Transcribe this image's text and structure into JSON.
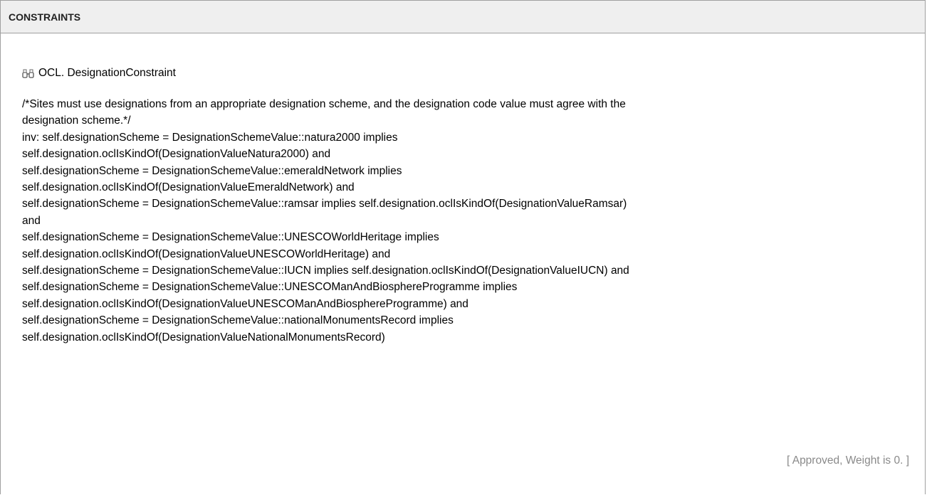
{
  "section": {
    "title": "CONSTRAINTS"
  },
  "constraint": {
    "icon": "binoculars-icon",
    "name": "OCL.  DesignationConstraint",
    "lines": [
      "/*Sites must use designations from an appropriate designation scheme, and the designation code value must agree with the",
      "designation scheme.*/",
      "inv: self.designationScheme = DesignationSchemeValue::natura2000 implies",
      "self.designation.oclIsKindOf(DesignationValueNatura2000) and",
      "self.designationScheme = DesignationSchemeValue::emeraldNetwork implies",
      "self.designation.oclIsKindOf(DesignationValueEmeraldNetwork) and",
      "self.designationScheme = DesignationSchemeValue::ramsar implies self.designation.oclIsKindOf(DesignationValueRamsar)",
      "and",
      "self.designationScheme = DesignationSchemeValue::UNESCOWorldHeritage implies",
      "self.designation.oclIsKindOf(DesignationValueUNESCOWorldHeritage) and",
      "self.designationScheme = DesignationSchemeValue::IUCN implies self.designation.oclIsKindOf(DesignationValueIUCN) and",
      "self.designationScheme = DesignationSchemeValue::UNESCOManAndBiosphereProgramme implies",
      "self.designation.oclIsKindOf(DesignationValueUNESCOManAndBiosphereProgramme) and",
      "self.designationScheme = DesignationSchemeValue::nationalMonumentsRecord implies",
      "self.designation.oclIsKindOf(DesignationValueNationalMonumentsRecord)"
    ],
    "status": "[ Approved, Weight is 0. ]"
  }
}
